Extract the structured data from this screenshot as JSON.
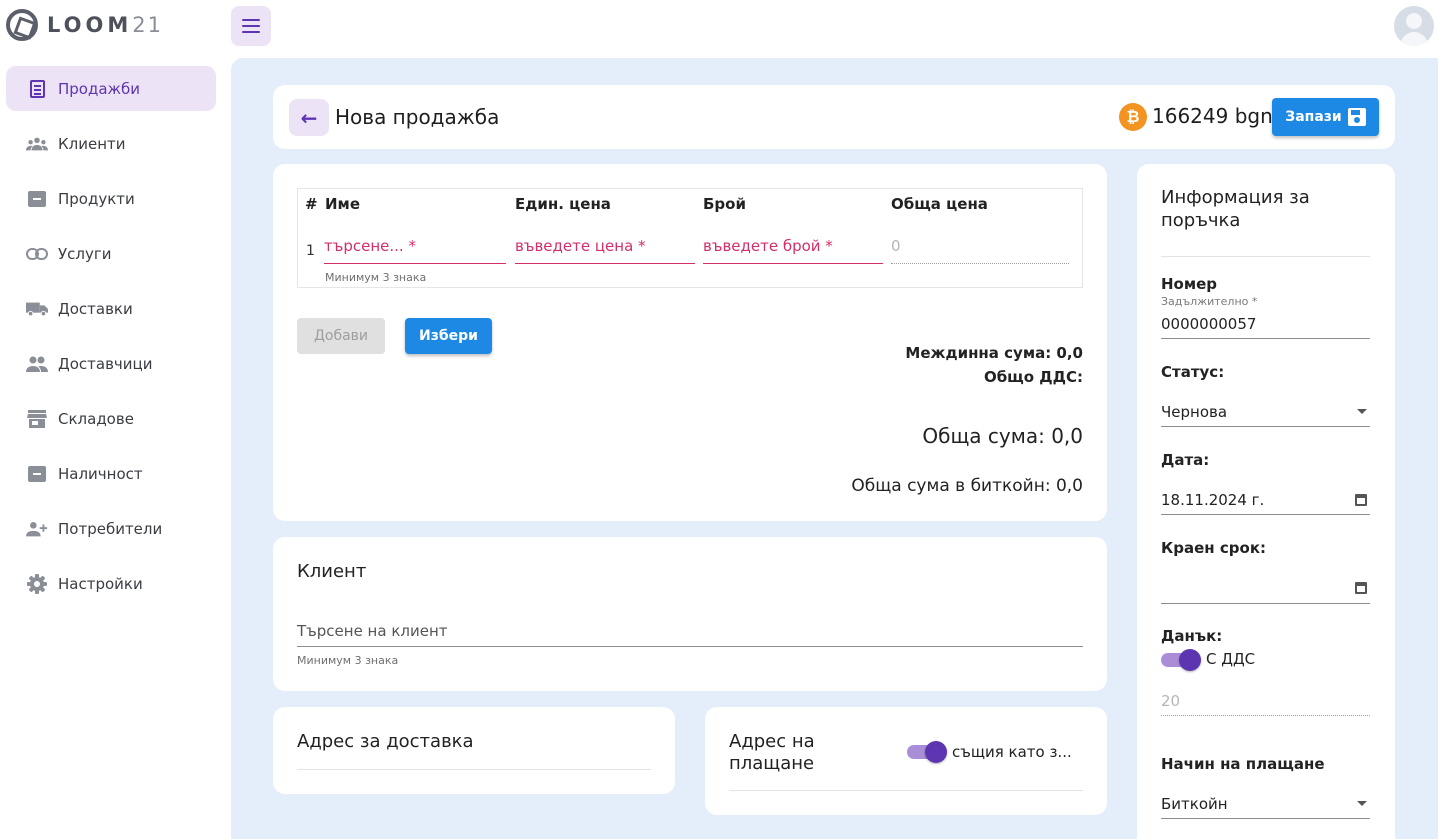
{
  "app": {
    "logo_text": "LOOM",
    "logo_num": "21"
  },
  "sidebar": {
    "items": [
      {
        "label": "Продажби",
        "icon": "receipt-icon",
        "active": true
      },
      {
        "label": "Клиенти",
        "icon": "groups-icon",
        "active": false
      },
      {
        "label": "Продукти",
        "icon": "archive-icon",
        "active": false
      },
      {
        "label": "Услуги",
        "icon": "link-icon",
        "active": false
      },
      {
        "label": "Доставки",
        "icon": "truck-icon",
        "active": false
      },
      {
        "label": "Доставчици",
        "icon": "people-icon",
        "active": false
      },
      {
        "label": "Складове",
        "icon": "store-icon",
        "active": false
      },
      {
        "label": "Наличност",
        "icon": "archive-icon",
        "active": false
      },
      {
        "label": "Потребители",
        "icon": "person-add-icon",
        "active": false
      },
      {
        "label": "Настройки",
        "icon": "gear-icon",
        "active": false
      }
    ]
  },
  "header": {
    "title": "Нова продажба",
    "balance": "166249 bgn",
    "btc_symbol": "₿",
    "save_label": "Запази"
  },
  "items": {
    "columns": {
      "num": "#",
      "name": "Име",
      "unit_price": "Един. цена",
      "qty": "Брой",
      "total": "Обща цена"
    },
    "row": {
      "num": "1",
      "name_placeholder": "търсене... *",
      "price_placeholder": "въведете цена *",
      "qty_placeholder": "въведете брой *",
      "total": "0",
      "name_hint": "Минимум 3 знака"
    },
    "add_label": "Добави",
    "choose_label": "Избери",
    "subtotal": "Междинна сума: 0,0",
    "vat_total": "Общо ДДС:",
    "grand_total": "Обща сума: 0,0",
    "btc_total": "Обща сума в биткойн: 0,0"
  },
  "client": {
    "title": "Клиент",
    "search_placeholder": "Търсене на клиент",
    "hint": "Минимум 3 знака"
  },
  "delivery": {
    "title": "Адрес за доставка"
  },
  "billing": {
    "title": "Адрес на плащане",
    "toggle_label": "същия като з..."
  },
  "order_info": {
    "title": "Информация за поръчка",
    "number_label": "Номер",
    "number_required": "Задължително *",
    "number_value": "0000000057",
    "status_label": "Статус:",
    "status_value": "Чернова",
    "date_label": "Дата:",
    "date_value": "18.11.2024 г.",
    "due_label": "Краен срок:",
    "due_value": "",
    "tax_label": "Данък:",
    "tax_toggle_label": "С ДДС",
    "tax_rate": "20",
    "payment_label": "Начин на плащане",
    "payment_value": "Биткойн"
  },
  "colors": {
    "accent": "#5e35b1",
    "primary_button": "#1e88e5",
    "background": "#e3eefa",
    "error": "#d32f6b",
    "bitcoin": "#f39321"
  }
}
